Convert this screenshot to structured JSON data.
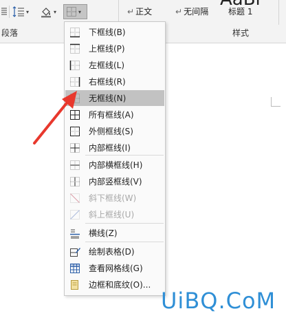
{
  "ribbon": {
    "group_paragraph": "段落",
    "group_styles": "样式",
    "styles": [
      {
        "marker": "↵",
        "label": "正文"
      },
      {
        "marker": "↵",
        "label": "无间隔"
      },
      {
        "marker": "",
        "label": "标题 1"
      }
    ],
    "style_preview": "AaBl"
  },
  "menu": {
    "items": [
      {
        "label": "下框线(B)",
        "icon": "border-bottom-icon",
        "state": "normal"
      },
      {
        "label": "上框线(P)",
        "icon": "border-top-icon",
        "state": "normal"
      },
      {
        "label": "左框线(L)",
        "icon": "border-left-icon",
        "state": "normal"
      },
      {
        "label": "右框线(R)",
        "icon": "border-right-icon",
        "state": "normal"
      },
      {
        "label": "无框线(N)",
        "icon": "border-none-icon",
        "state": "selected"
      },
      {
        "label": "所有框线(A)",
        "icon": "border-all-icon",
        "state": "normal"
      },
      {
        "label": "外侧框线(S)",
        "icon": "border-outside-icon",
        "state": "normal"
      },
      {
        "label": "内部框线(I)",
        "icon": "border-inside-icon",
        "state": "normal"
      },
      {
        "label": "内部横框线(H)",
        "icon": "border-inside-horizontal-icon",
        "state": "normal"
      },
      {
        "label": "内部竖框线(V)",
        "icon": "border-inside-vertical-icon",
        "state": "normal"
      },
      {
        "label": "斜下框线(W)",
        "icon": "diagonal-down-icon",
        "state": "disabled"
      },
      {
        "label": "斜上框线(U)",
        "icon": "diagonal-up-icon",
        "state": "disabled"
      },
      {
        "label": "横线(Z)",
        "icon": "horizontal-line-icon",
        "state": "normal"
      },
      {
        "label": "绘制表格(D)",
        "icon": "draw-table-icon",
        "state": "normal"
      },
      {
        "label": "查看网格线(G)",
        "icon": "view-gridlines-icon",
        "state": "normal"
      },
      {
        "label": "边框和底纹(O)...",
        "icon": "borders-shading-icon",
        "state": "normal"
      }
    ]
  },
  "watermark": "UiBQ.CoM",
  "colors": {
    "ribbon_bg": "#f3f3f3",
    "selected_bg": "#c2c2c2",
    "arrow": "#e8382d",
    "watermark": "#2f8fd6"
  }
}
